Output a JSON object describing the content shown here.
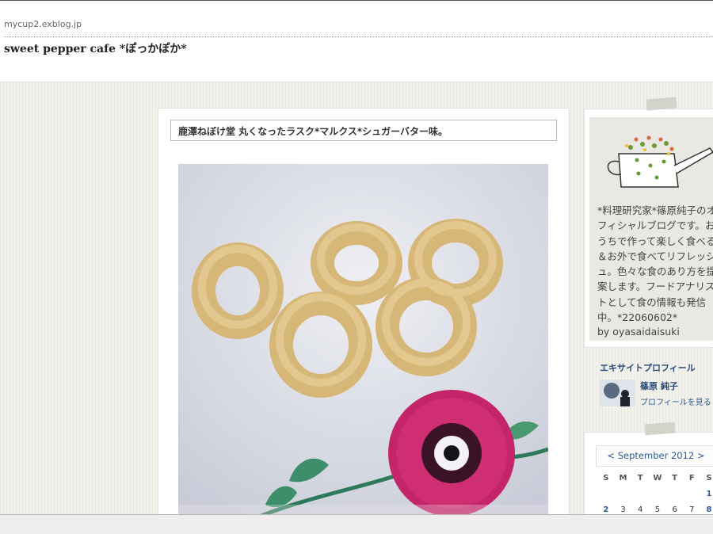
{
  "header": {
    "domain": "mycup2.exblog.jp",
    "site_title": "sweet pepper cafe *ぽっかぽか*"
  },
  "post": {
    "title": "鹿澤ねぼけ堂 丸くなったラスク*マルクス*シュガーバター味。"
  },
  "sidebar": {
    "profile_text": "*料理研究家*篠原純子のオフィシャルブログです。おうちで作って楽しく食べる＆お外で食べてリフレッシュ。色々な食のあり方を提案します。フードアナリストとして食の情報も発信中。*22060602*",
    "profile_by": "by oyasaidaisuki",
    "excite_label": "エキサイトプロフィール",
    "author_name": "篠原 純子",
    "profile_link": "プロフィールを見る"
  },
  "calendar": {
    "month_label": "< September 2012 >",
    "weekdays": [
      "S",
      "M",
      "T",
      "W",
      "T",
      "F",
      "S"
    ],
    "row1": [
      "",
      "",
      "",
      "",
      "",
      "",
      "1"
    ],
    "row2": [
      "2",
      "3",
      "4",
      "5",
      "6",
      "7",
      "8"
    ]
  },
  "colors": {
    "link": "#2a5a9a",
    "sunday": "#c03030",
    "page_bg": "#f2f1ea"
  }
}
